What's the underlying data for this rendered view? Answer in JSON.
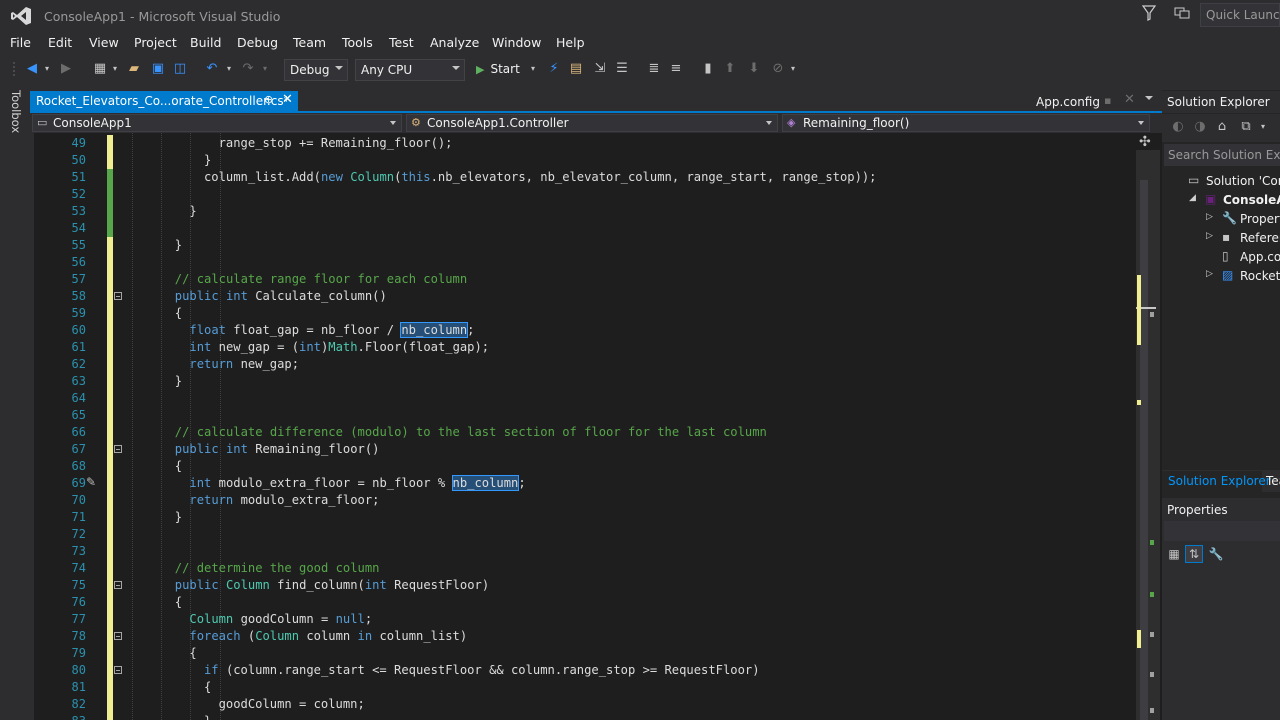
{
  "window": {
    "title": "ConsoleApp1 - Microsoft Visual Studio",
    "quick_launch_placeholder": "Quick Launch (C"
  },
  "menu": [
    "File",
    "Edit",
    "View",
    "Project",
    "Build",
    "Debug",
    "Team",
    "Tools",
    "Test",
    "Analyze",
    "Window",
    "Help"
  ],
  "toolbar": {
    "config": "Debug",
    "platform": "Any CPU",
    "start_label": "Start"
  },
  "toolbox_label": "Toolbox",
  "tabs": {
    "active": "Rocket_Elevators_Co...orate_Controller.cs*",
    "preview": "App.config"
  },
  "navbar": {
    "project": "ConsoleApp1",
    "type": "ConsoleApp1.Controller",
    "member": "Remaining_floor()"
  },
  "colors": {
    "accent": "#007acc",
    "keyword": "#569cd6",
    "type": "#4ec9b0",
    "comment": "#57a64a",
    "text": "#dcdcdc",
    "line_number": "#2b91af",
    "change_saved": "#57a64a",
    "change_unsaved": "#efef91"
  },
  "code_lines": [
    {
      "n": "49",
      "ind": 6,
      "chg": "y",
      "tokens": [
        [
          "range_stop += Remaining_floor();",
          "t"
        ]
      ]
    },
    {
      "n": "50",
      "ind": 5,
      "chg": "y",
      "tokens": [
        [
          "}",
          "t"
        ]
      ]
    },
    {
      "n": "51",
      "ind": 5,
      "chg": "g",
      "tokens": [
        [
          "column_list.Add(",
          "t"
        ],
        [
          "new ",
          "k"
        ],
        [
          "Column",
          "c"
        ],
        [
          "(",
          "t"
        ],
        [
          "this",
          "k"
        ],
        [
          ".nb_elevators, nb_elevator_column, range_start, range_stop));",
          "t"
        ]
      ]
    },
    {
      "n": "52",
      "ind": 0,
      "chg": "g",
      "tokens": []
    },
    {
      "n": "53",
      "ind": 4,
      "chg": "g",
      "tokens": [
        [
          "}",
          "t"
        ]
      ]
    },
    {
      "n": "54",
      "ind": 0,
      "chg": "g",
      "tokens": []
    },
    {
      "n": "55",
      "ind": 3,
      "chg": "y",
      "tokens": [
        [
          "}",
          "t"
        ]
      ]
    },
    {
      "n": "56",
      "ind": 0,
      "chg": "y",
      "tokens": []
    },
    {
      "n": "57",
      "ind": 3,
      "chg": "y",
      "tokens": [
        [
          "// calculate range floor for each column",
          "m"
        ]
      ]
    },
    {
      "n": "58",
      "ind": 3,
      "chg": "y",
      "fold": true,
      "tokens": [
        [
          "public int ",
          "k"
        ],
        [
          "Calculate_column()",
          "t"
        ]
      ]
    },
    {
      "n": "59",
      "ind": 3,
      "chg": "y",
      "tokens": [
        [
          "{",
          "t"
        ]
      ]
    },
    {
      "n": "60",
      "ind": 4,
      "chg": "y",
      "tokens": [
        [
          "float ",
          "k"
        ],
        [
          "float_gap = nb_floor / ",
          "t"
        ],
        [
          "nb_column",
          "h"
        ],
        [
          ";",
          "t"
        ]
      ]
    },
    {
      "n": "61",
      "ind": 4,
      "chg": "y",
      "tokens": [
        [
          "int ",
          "k"
        ],
        [
          "new_gap = (",
          "t"
        ],
        [
          "int",
          "k"
        ],
        [
          ")",
          "t"
        ],
        [
          "Math",
          "c"
        ],
        [
          ".Floor(float_gap);",
          "t"
        ]
      ]
    },
    {
      "n": "62",
      "ind": 4,
      "chg": "y",
      "tokens": [
        [
          "return ",
          "k"
        ],
        [
          "new_gap;",
          "t"
        ]
      ]
    },
    {
      "n": "63",
      "ind": 3,
      "chg": "y",
      "tokens": [
        [
          "}",
          "t"
        ]
      ]
    },
    {
      "n": "64",
      "ind": 0,
      "chg": "y",
      "tokens": []
    },
    {
      "n": "65",
      "ind": 0,
      "chg": "y",
      "tokens": []
    },
    {
      "n": "66",
      "ind": 3,
      "chg": "y",
      "tokens": [
        [
          "// calculate difference (modulo) to the last section of floor for the last column",
          "m"
        ]
      ]
    },
    {
      "n": "67",
      "ind": 3,
      "chg": "y",
      "fold": true,
      "tokens": [
        [
          "public int ",
          "k"
        ],
        [
          "Remaining_floor()",
          "t"
        ]
      ]
    },
    {
      "n": "68",
      "ind": 3,
      "chg": "y",
      "tokens": [
        [
          "{",
          "t"
        ]
      ]
    },
    {
      "n": "69",
      "ind": 4,
      "chg": "y",
      "brush": true,
      "tokens": [
        [
          "int ",
          "k"
        ],
        [
          "modulo_extra_floor = nb_floor % ",
          "t"
        ],
        [
          "nb_column",
          "h"
        ],
        [
          ";",
          "t"
        ]
      ]
    },
    {
      "n": "70",
      "ind": 4,
      "chg": "y",
      "tokens": [
        [
          "return ",
          "k"
        ],
        [
          "modulo_extra_floor;",
          "t"
        ]
      ]
    },
    {
      "n": "71",
      "ind": 3,
      "chg": "y",
      "tokens": [
        [
          "}",
          "t"
        ]
      ]
    },
    {
      "n": "72",
      "ind": 0,
      "chg": "y",
      "tokens": []
    },
    {
      "n": "73",
      "ind": 0,
      "chg": "y",
      "tokens": []
    },
    {
      "n": "74",
      "ind": 3,
      "chg": "y",
      "tokens": [
        [
          "// determine the good column",
          "m"
        ]
      ]
    },
    {
      "n": "75",
      "ind": 3,
      "chg": "y",
      "fold": true,
      "tokens": [
        [
          "public ",
          "k"
        ],
        [
          "Column ",
          "c"
        ],
        [
          "find_column(",
          "t"
        ],
        [
          "int ",
          "k"
        ],
        [
          "RequestFloor)",
          "t"
        ]
      ]
    },
    {
      "n": "76",
      "ind": 3,
      "chg": "y",
      "tokens": [
        [
          "{",
          "t"
        ]
      ]
    },
    {
      "n": "77",
      "ind": 4,
      "chg": "y",
      "tokens": [
        [
          "Column ",
          "c"
        ],
        [
          "goodColumn = ",
          "t"
        ],
        [
          "null",
          "k"
        ],
        [
          ";",
          "t"
        ]
      ]
    },
    {
      "n": "78",
      "ind": 4,
      "chg": "y",
      "fold": true,
      "tokens": [
        [
          "foreach ",
          "k"
        ],
        [
          "(",
          "t"
        ],
        [
          "Column ",
          "c"
        ],
        [
          "column ",
          "t"
        ],
        [
          "in ",
          "k"
        ],
        [
          "column_list)",
          "t"
        ]
      ]
    },
    {
      "n": "79",
      "ind": 4,
      "chg": "y",
      "tokens": [
        [
          "{",
          "t"
        ]
      ]
    },
    {
      "n": "80",
      "ind": 5,
      "chg": "y",
      "fold": true,
      "tokens": [
        [
          "if ",
          "k"
        ],
        [
          "(column.range_start <= RequestFloor && column.range_stop >= RequestFloor)",
          "t"
        ]
      ]
    },
    {
      "n": "81",
      "ind": 5,
      "chg": "y",
      "tokens": [
        [
          "{",
          "t"
        ]
      ]
    },
    {
      "n": "82",
      "ind": 6,
      "chg": "y",
      "tokens": [
        [
          "goodColumn = column;",
          "t"
        ]
      ]
    },
    {
      "n": "83",
      "ind": 5,
      "chg": "y",
      "tokens": [
        [
          "}",
          "t"
        ]
      ]
    }
  ],
  "solution_explorer": {
    "title": "Solution Explorer",
    "search_placeholder": "Search Solution Explorer",
    "items": [
      {
        "label": "Solution 'ConsoleApp1'",
        "depth": 0,
        "icon": "solution-icon",
        "exp": ""
      },
      {
        "label": "ConsoleApp1",
        "depth": 1,
        "icon": "csharp-project-icon",
        "exp": "◢",
        "bold": true
      },
      {
        "label": "Properties",
        "depth": 2,
        "icon": "wrench-icon",
        "exp": "▷"
      },
      {
        "label": "References",
        "depth": 2,
        "icon": "references-icon",
        "exp": "▷"
      },
      {
        "label": "App.config",
        "depth": 2,
        "icon": "config-file-icon",
        "exp": ""
      },
      {
        "label": "Rocket_Elevators",
        "depth": 2,
        "icon": "csharp-file-icon",
        "exp": "▷"
      }
    ],
    "tab_primary": "Solution Explorer",
    "tab_secondary": "Team Explorer"
  },
  "properties": {
    "title": "Properties"
  }
}
